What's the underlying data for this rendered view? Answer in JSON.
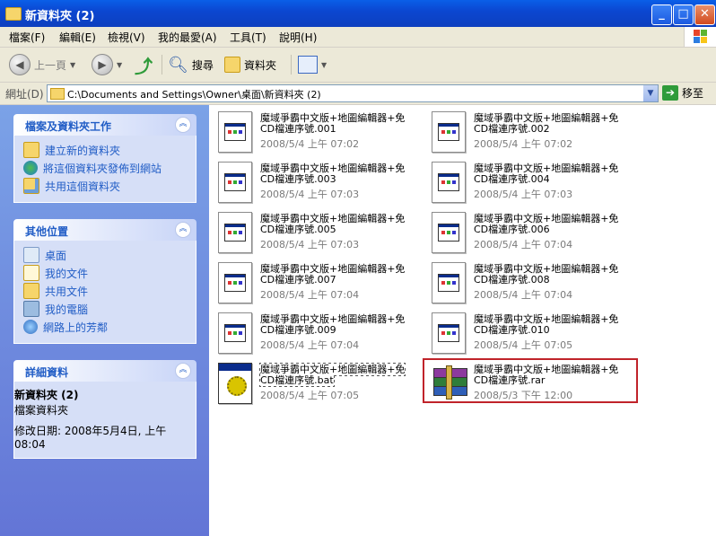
{
  "window": {
    "title": "新資料夾 (2)"
  },
  "menu": [
    "檔案(F)",
    "編輯(E)",
    "檢視(V)",
    "我的最愛(A)",
    "工具(T)",
    "說明(H)"
  ],
  "toolbar": {
    "back": "上一頁",
    "search": "搜尋",
    "folders": "資料夾"
  },
  "address": {
    "label": "網址(D)",
    "path": "C:\\Documents and Settings\\Owner\\桌面\\新資料夾 (2)",
    "go": "移至"
  },
  "tasks_panel": {
    "title": "檔案及資料夾工作",
    "items": [
      "建立新的資料夾",
      "將這個資料夾發佈到網站",
      "共用這個資料夾"
    ]
  },
  "places_panel": {
    "title": "其他位置",
    "items": [
      "桌面",
      "我的文件",
      "共用文件",
      "我的電腦",
      "網路上的芳鄰"
    ]
  },
  "details_panel": {
    "title": "詳細資料",
    "name": "新資料夾 (2)",
    "type": "檔案資料夾",
    "modified": "修改日期: 2008年5月4日, 上午 08:04"
  },
  "files": [
    {
      "name": "魔域爭霸中文版+地圖編輯器+免CD檔連序號.001",
      "date": "2008/5/4 上午 07:02"
    },
    {
      "name": "魔域爭霸中文版+地圖編輯器+免CD檔連序號.002",
      "date": "2008/5/4 上午 07:02"
    },
    {
      "name": "魔域爭霸中文版+地圖編輯器+免CD檔連序號.003",
      "date": "2008/5/4 上午 07:03"
    },
    {
      "name": "魔域爭霸中文版+地圖編輯器+免CD檔連序號.004",
      "date": "2008/5/4 上午 07:03"
    },
    {
      "name": "魔域爭霸中文版+地圖編輯器+免CD檔連序號.005",
      "date": "2008/5/4 上午 07:03"
    },
    {
      "name": "魔域爭霸中文版+地圖編輯器+免CD檔連序號.006",
      "date": "2008/5/4 上午 07:04"
    },
    {
      "name": "魔域爭霸中文版+地圖編輯器+免CD檔連序號.007",
      "date": "2008/5/4 上午 07:04"
    },
    {
      "name": "魔域爭霸中文版+地圖編輯器+免CD檔連序號.008",
      "date": "2008/5/4 上午 07:04"
    },
    {
      "name": "魔域爭霸中文版+地圖編輯器+免CD檔連序號.009",
      "date": "2008/5/4 上午 07:04"
    },
    {
      "name": "魔域爭霸中文版+地圖編輯器+免CD檔連序號.010",
      "date": "2008/5/4 上午 07:05"
    },
    {
      "name": "魔域爭霸中文版+地圖編輯器+免CD檔連序號.bat",
      "date": "2008/5/4 上午 07:05"
    },
    {
      "name": "魔域爭霸中文版+地圖編輯器+免CD檔連序號.rar",
      "date": "2008/5/3 下午 12:00"
    }
  ],
  "colors": {
    "link": "#215dc6",
    "titlebar": "#0b47d1",
    "highlight": "#c0232a"
  }
}
